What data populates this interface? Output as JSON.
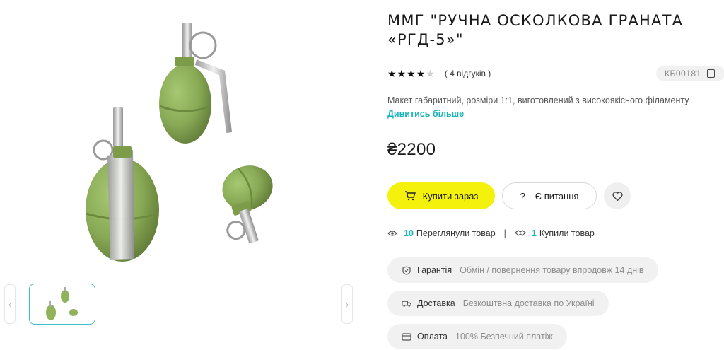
{
  "product": {
    "title": "ММГ \"РУЧНА ОСКОЛКОВА ГРАНАТА «РГД-5»\"",
    "rating": 4,
    "rating_max": 5,
    "reviews_text": "( 4 відгуків )",
    "sku": "КБ00181",
    "description": "Макет габаритний, розміри 1:1, виготовлений з високоякісного філаменту",
    "more_link": "Дивитись більше",
    "price": "₴2200"
  },
  "actions": {
    "buy_label": "Купити зараз",
    "ask_icon": "?",
    "ask_label": "Є питання"
  },
  "stats": {
    "views_count": "10",
    "views_label": "Переглянули товар",
    "separator": "|",
    "bought_count": "1",
    "bought_label": "Купили товар"
  },
  "features": [
    {
      "icon": "shield-icon",
      "label": "Гарантія",
      "text": "Обмін / повернення товару впродовж 14 днів"
    },
    {
      "icon": "truck-icon",
      "label": "Доставка",
      "text": "Безкоштвна доставка по Україні"
    },
    {
      "icon": "card-icon",
      "label": "Оплата",
      "text": "100% Безпечний платіж"
    }
  ],
  "gallery": {
    "prev_arrow": "‹",
    "next_arrow": "›",
    "thumbnail_count": 1
  },
  "colors": {
    "accent_yellow": "#f4f20d",
    "accent_teal": "#19b3b8",
    "grenade_green": "#8fb25a"
  }
}
